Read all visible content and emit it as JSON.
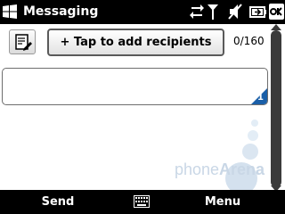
{
  "titlebar": {
    "app_title": "Messaging",
    "icons": [
      "windows-flag-icon",
      "data-transfer-icon",
      "signal-strength-icon",
      "speaker-muted-icon",
      "battery-icon",
      "ok-button"
    ],
    "ok_label": "ok"
  },
  "compose": {
    "recipients_label": "+ Tap to add recipients",
    "char_count": "0/160",
    "message_value": "",
    "page_badge": "1"
  },
  "softkeys": {
    "left": "Send",
    "right": "Menu"
  },
  "watermark": {
    "brand_phone": "phone",
    "brand_arena": "Arena"
  },
  "colors": {
    "bar_bg": "#000000",
    "accent_blue": "#1a5fa8",
    "scrollbar": "#3b3b3b"
  }
}
